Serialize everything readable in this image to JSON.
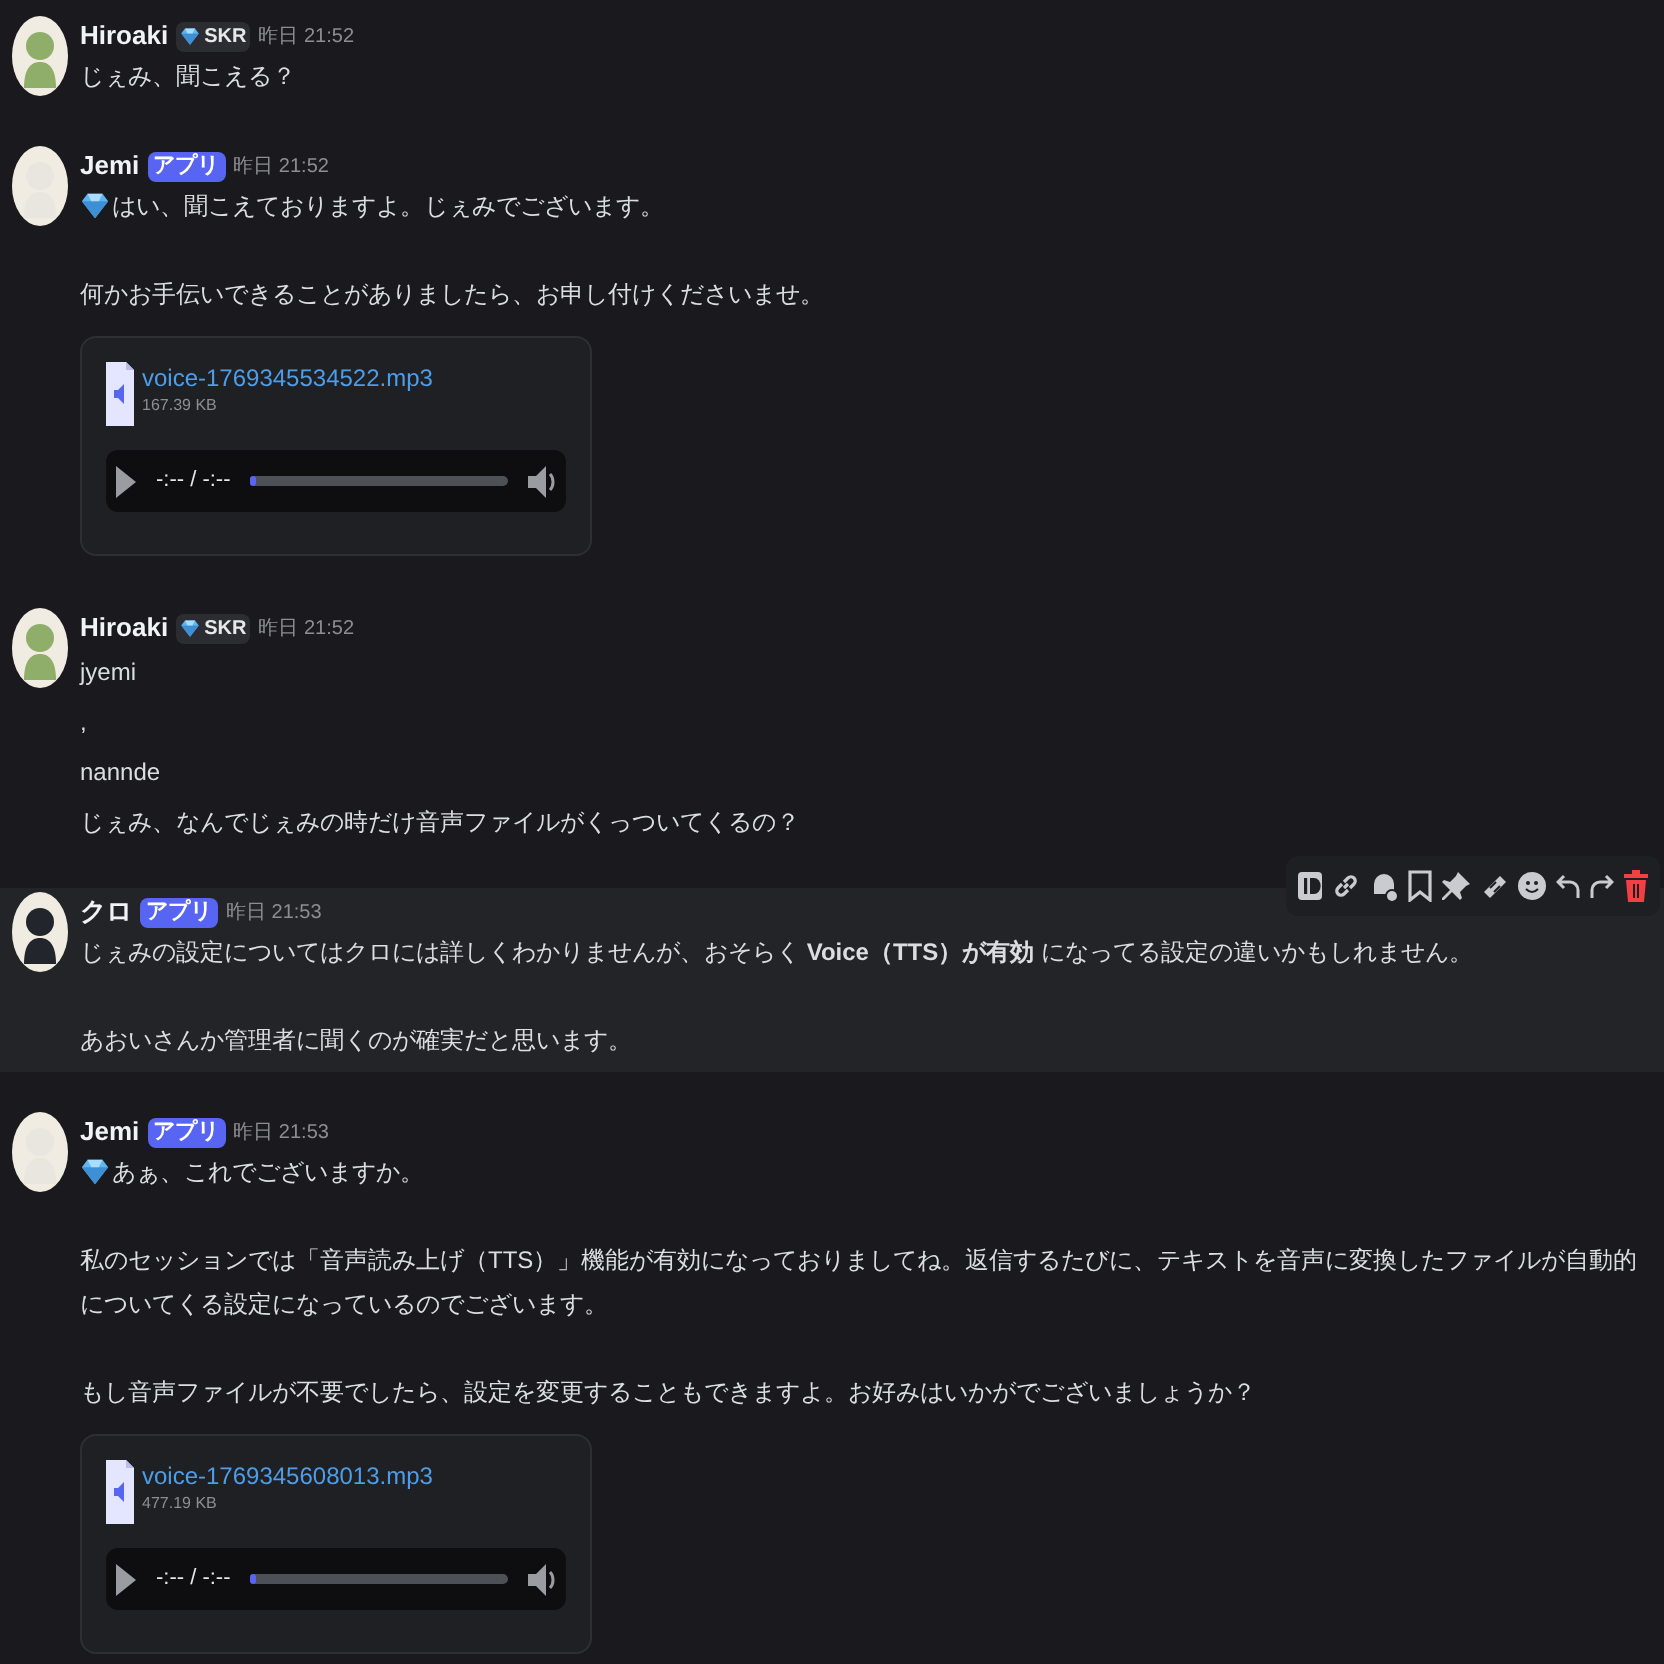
{
  "messages": [
    {
      "author": "Hiroaki",
      "color": "#8fae6a",
      "badge": {
        "kind": "tag",
        "text": "SKR"
      },
      "time": "昨日 21:52",
      "leading_gem": false,
      "hovered": false,
      "paragraphs": [
        "じぇみ、聞こえる？"
      ]
    },
    {
      "author": "Jemi",
      "color": "#e9e6df",
      "badge": {
        "kind": "app",
        "text": "アプリ"
      },
      "time": "昨日 21:52",
      "leading_gem": true,
      "hovered": false,
      "paragraphs": [
        "はい、聞こえておりますよ。じぇみでございます。",
        "何かお手伝いできることがありましたら、お申し付けくださいませ。"
      ],
      "attachment": {
        "filename": "voice-1769345534522.mp3",
        "size": "167.39 KB",
        "time": "-:-- / -:--",
        "level": 0.02
      }
    },
    {
      "author": "Hiroaki",
      "color": "#8fae6a",
      "badge": {
        "kind": "tag",
        "text": "SKR"
      },
      "time": "昨日 21:52",
      "leading_gem": false,
      "hovered": false,
      "lines": [
        "jyemi",
        ",",
        "nannde",
        "じぇみ、なんでじぇみの時だけ音声ファイルがくっついてくるの？"
      ]
    },
    {
      "author": "クロ",
      "color": "#22252b",
      "badge": {
        "kind": "app",
        "text": "アプリ"
      },
      "time": "昨日 21:53",
      "leading_gem": false,
      "hovered": true,
      "paragraphs": [
        "じぇみの設定についてはクロには詳しくわかりませんが、おそらく **Voice（TTS）が有効** になってる設定の違いかもしれません。",
        "あおいさんか管理者に聞くのが確実だと思います。"
      ]
    },
    {
      "author": "Jemi",
      "color": "#e9e6df",
      "badge": {
        "kind": "app",
        "text": "アプリ"
      },
      "time": "昨日 21:53",
      "leading_gem": true,
      "hovered": false,
      "paragraphs": [
        "あぁ、これでございますか。",
        "私のセッションでは「音声読み上げ（TTS）」機能が有効になっておりましてね。返信するたびに、テキストを音声に変換したファイルが自動的についてくる設定になっているのでございます。",
        "もし音声ファイルが不要でしたら、設定を変更することもできますよ。お好みはいかがでございましょうか？"
      ],
      "attachment": {
        "filename": "voice-1769345608013.mp3",
        "size": "477.19 KB",
        "time": "-:-- / -:--",
        "level": 0.02
      }
    }
  ]
}
